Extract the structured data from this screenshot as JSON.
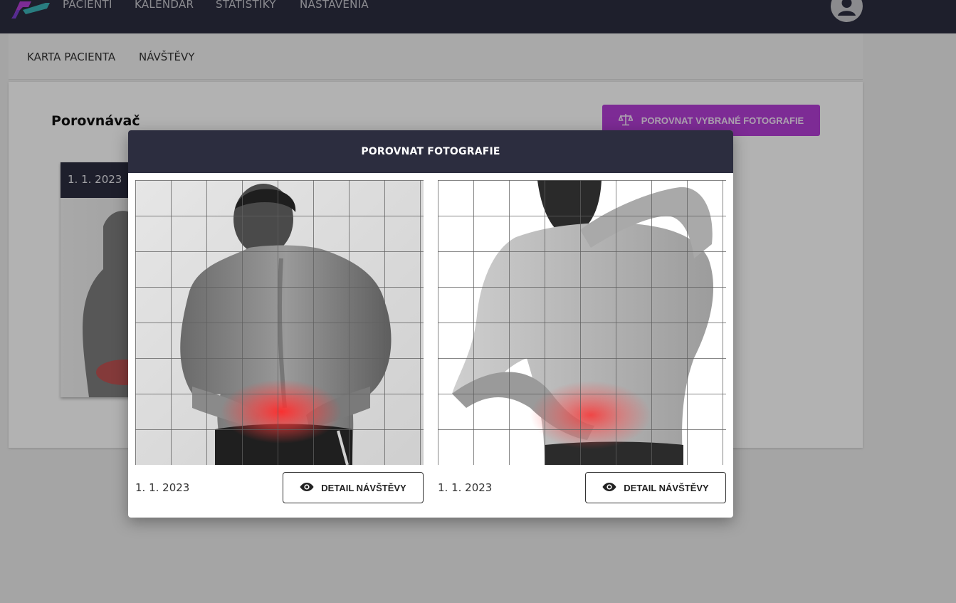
{
  "nav": {
    "items": [
      {
        "label": "PACIENTI"
      },
      {
        "label": "KALENDÁR"
      },
      {
        "label": "ŠTATISTIKY"
      },
      {
        "label": "NASTAVENIA"
      }
    ],
    "avatar_icon": "user-avatar-icon"
  },
  "subtabs": [
    {
      "label": "KARTA PACIENTA"
    },
    {
      "label": "NÁVŠTĚVY"
    }
  ],
  "panel": {
    "title": "Porovnávač",
    "compare_button": "POROVNAT VYBRANÉ FOTOGRAFIE",
    "compare_icon": "scale-icon",
    "card_date": "1. 1. 2023"
  },
  "modal": {
    "title": "POROVNAT FOTOGRAFIE",
    "photos": [
      {
        "date": "1. 1. 2023",
        "button_label": "DETAIL NÁVŠTĚVY",
        "button_icon": "eye-icon"
      },
      {
        "date": "1. 1. 2023",
        "button_label": "DETAIL NÁVŠTĚVY",
        "button_icon": "eye-icon"
      }
    ]
  },
  "colors": {
    "nav_bg": "#2c2d3f",
    "accent": "#b43ed6",
    "pain_highlight": "#ff2a2a"
  }
}
